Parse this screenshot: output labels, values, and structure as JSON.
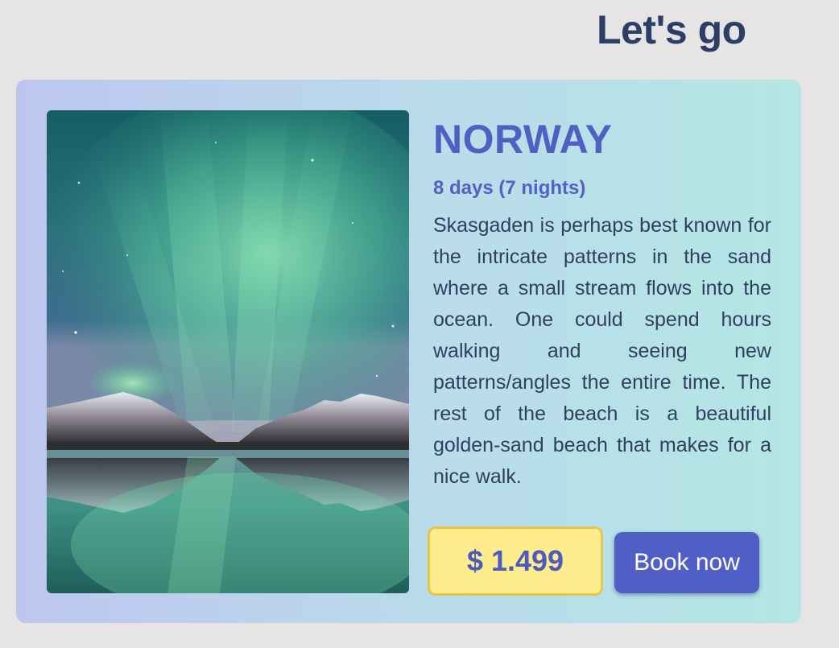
{
  "header": {
    "title": "Let's go"
  },
  "card": {
    "country": "NORWAY",
    "duration": "8 days (7 nights)",
    "description": "Skasgaden is perhaps best known for the intricate patterns in the sand where a small stream flows into the ocean. One could spend hours walking and seeing new patterns/angles the entire time. The rest of the beach is a beautiful golden-sand beach that makes for a nice walk.",
    "price": "$ 1.499",
    "book_label": "Book now",
    "image_icon": "aurora-landscape-photo"
  },
  "colors": {
    "page_background": "#e6e4e5",
    "title": "#2c3e66",
    "accent": "#4f5fc6",
    "price_background": "#ffec8c",
    "price_border": "#e3c74d",
    "body_text": "#2f3f5e",
    "card_gradient_start": "#bdc6ef",
    "card_gradient_end": "#b4e6e4"
  }
}
